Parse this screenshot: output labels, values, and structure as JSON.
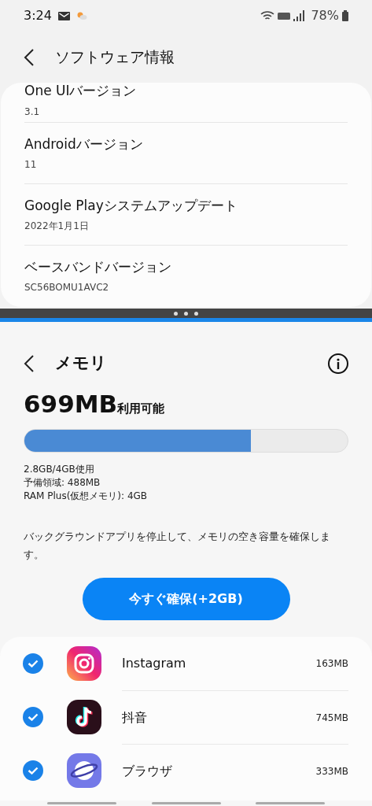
{
  "status_bar": {
    "time": "3:24",
    "battery": "78%"
  },
  "top_window": {
    "title": "ソフトウェア情報",
    "items": [
      {
        "title": "One UIバージョン",
        "value": "3.1"
      },
      {
        "title": "Androidバージョン",
        "value": "11"
      },
      {
        "title": "Google Playシステムアップデート",
        "value": "2022年1月1日"
      },
      {
        "title": "ベースバンドバージョン",
        "value": "SC56BOMU1AVC2"
      }
    ]
  },
  "memory": {
    "title": "メモリ",
    "available_amount": "699MB",
    "available_label": "利用可能",
    "usage": {
      "level": 0.7
    },
    "details": [
      "2.8GB/4GB使用",
      "予備領域: 488MB",
      "RAM Plus(仮想メモリ): 4GB"
    ],
    "description": "バックグラウンドアプリを停止して、メモリの空き容量を確保します。",
    "button": "今すぐ確保(+2GB)",
    "apps": [
      {
        "name": "Instagram",
        "size": "163MB",
        "checked": true,
        "kind": "camera"
      },
      {
        "name": "抖音",
        "size": "745MB",
        "checked": true,
        "kind": "note"
      },
      {
        "name": "ブラウザ",
        "size": "333MB",
        "checked": true,
        "kind": "planet"
      }
    ]
  }
}
